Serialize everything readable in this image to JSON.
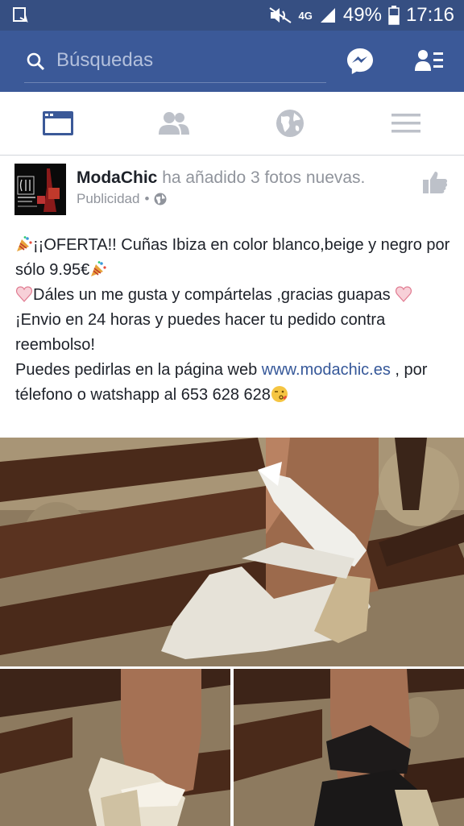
{
  "status_bar": {
    "network": "4G",
    "battery": "49%",
    "time": "17:16"
  },
  "search": {
    "placeholder": "Búsquedas"
  },
  "post": {
    "page_name": "ModaChic",
    "action_text": "ha añadido 3 fotos nuevas.",
    "sponsored_label": "Publicidad",
    "separator": "•",
    "line1": "¡¡OFERTA!! Cuñas Ibiza en color blanco,beige y negro por sólo 9.95€",
    "line2": "Dáles un me gusta y compártelas ,gracias guapas",
    "line3": "¡Envio en 24 horas y puedes hacer tu pedido contra reembolso!",
    "line4_prefix": "Puedes pedirlas en la página web ",
    "link": "www.modachic.es",
    "line4_suffix": " , por télefono o watshapp al 653 628 628"
  },
  "colors": {
    "brand": "#3b5998",
    "status_bar": "#364f82",
    "link": "#365899",
    "text": "#1d2129",
    "muted": "#90949c"
  },
  "icons": [
    "search-icon",
    "messenger-icon",
    "friend-requests-icon",
    "news-feed-icon",
    "friends-icon",
    "globe-icon",
    "menu-icon",
    "like-icon",
    "party-popper-icon",
    "heart-icon",
    "wink-kiss-icon"
  ]
}
